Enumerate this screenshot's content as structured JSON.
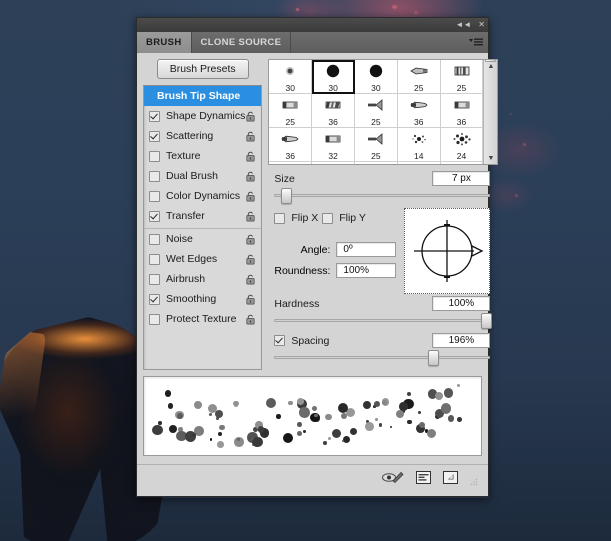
{
  "window": {
    "collapse_label": "◄◄",
    "close_label": "✕",
    "panel_menu_icon": "panel-menu-icon"
  },
  "tabs": [
    {
      "label": "BRUSH",
      "active": true
    },
    {
      "label": "CLONE SOURCE",
      "active": false
    }
  ],
  "toolbar": {
    "brush_presets_label": "Brush Presets"
  },
  "options": [
    {
      "label": "Brush Tip Shape",
      "header": true,
      "checked": false,
      "locked": false,
      "sep": false
    },
    {
      "label": "Shape Dynamics",
      "header": false,
      "checked": true,
      "locked": true,
      "sep": false
    },
    {
      "label": "Scattering",
      "header": false,
      "checked": true,
      "locked": true,
      "sep": false
    },
    {
      "label": "Texture",
      "header": false,
      "checked": false,
      "locked": true,
      "sep": false
    },
    {
      "label": "Dual Brush",
      "header": false,
      "checked": false,
      "locked": true,
      "sep": false
    },
    {
      "label": "Color Dynamics",
      "header": false,
      "checked": false,
      "locked": true,
      "sep": false
    },
    {
      "label": "Transfer",
      "header": false,
      "checked": true,
      "locked": true,
      "sep": false
    },
    {
      "label": "Noise",
      "header": false,
      "checked": false,
      "locked": true,
      "sep": true
    },
    {
      "label": "Wet Edges",
      "header": false,
      "checked": false,
      "locked": true,
      "sep": false
    },
    {
      "label": "Airbrush",
      "header": false,
      "checked": false,
      "locked": true,
      "sep": false
    },
    {
      "label": "Smoothing",
      "header": false,
      "checked": true,
      "locked": true,
      "sep": false
    },
    {
      "label": "Protect Texture",
      "header": false,
      "checked": false,
      "locked": true,
      "sep": false
    }
  ],
  "brush_grid": {
    "scroll_up_label": "▲",
    "scroll_down_label": "▼",
    "presets": [
      {
        "size": "30",
        "shape": "soft-round",
        "selected": false
      },
      {
        "size": "30",
        "shape": "hard-round",
        "selected": true
      },
      {
        "size": "30",
        "shape": "hard-round",
        "selected": false
      },
      {
        "size": "25",
        "shape": "flat-tip",
        "selected": false
      },
      {
        "size": "25",
        "shape": "bristle-flat",
        "selected": false
      },
      {
        "size": "25",
        "shape": "flat-block",
        "selected": false
      },
      {
        "size": "36",
        "shape": "bristle-angled",
        "selected": false
      },
      {
        "size": "25",
        "shape": "fan-tip",
        "selected": false
      },
      {
        "size": "36",
        "shape": "round-point",
        "selected": false
      },
      {
        "size": "36",
        "shape": "flat-block",
        "selected": false
      },
      {
        "size": "36",
        "shape": "round-point",
        "selected": false
      },
      {
        "size": "32",
        "shape": "flat-block",
        "selected": false
      },
      {
        "size": "25",
        "shape": "fan-tip",
        "selected": false
      },
      {
        "size": "14",
        "shape": "spatter",
        "selected": false
      },
      {
        "size": "24",
        "shape": "scatter-spray",
        "selected": false
      }
    ]
  },
  "controls": {
    "size_label": "Size",
    "size_value": "7 px",
    "size_percent": 3,
    "flip_x_label": "Flip X",
    "flip_x_checked": false,
    "flip_y_label": "Flip Y",
    "flip_y_checked": false,
    "angle_label": "Angle:",
    "angle_value": "0º",
    "roundness_label": "Roundness:",
    "roundness_value": "100%",
    "hardness_label": "Hardness",
    "hardness_value": "100%",
    "hardness_percent": 100,
    "spacing_label": "Spacing",
    "spacing_checked": true,
    "spacing_value": "196%",
    "spacing_percent": 74
  },
  "footer": {
    "icons": [
      {
        "name": "toggle-brush-preview-icon",
        "title": "Toggle brush preview"
      },
      {
        "name": "create-new-brush-icon",
        "title": "Create new brush"
      },
      {
        "name": "delete-brush-icon",
        "title": "Delete brush"
      }
    ],
    "resize_grip": "resize-grip-icon"
  },
  "accent_colors": {
    "selection_blue": "#2a8fe0",
    "panel_gray": "#d4d4d4",
    "titlebar_dark": "#3b3b3b",
    "backdrop_blue": "#2b3f58",
    "spark_red": "#e26e78"
  }
}
